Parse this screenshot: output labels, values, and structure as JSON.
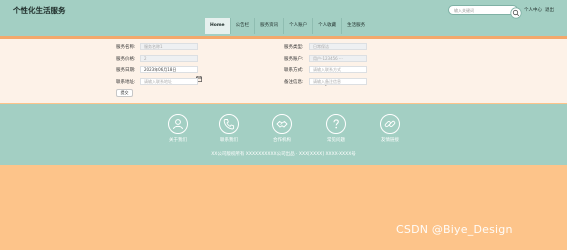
{
  "header": {
    "logo": "个性化生活服务",
    "search_placeholder": "输入关键词",
    "user_center": "个人中心",
    "logout": "退出",
    "nav": [
      "Home",
      "公告栏",
      "服务资讯",
      "个人账户",
      "个人收藏",
      "生活服务"
    ]
  },
  "form": {
    "service_name_label": "服务名称:",
    "service_name_value": "服务名称1",
    "service_type_label": "服务类型:",
    "service_type_value": "日常保洁",
    "service_count_label": "服务价格:",
    "service_count_value": "2",
    "service_account_label": "服务账户:",
    "service_account_value": "用户-123456 ···",
    "service_date_label": "服务日期:",
    "service_date_value": "2023年06月18日",
    "contact_method_label": "联系方式:",
    "contact_method_placeholder": "请输入联系方式",
    "contact_address_label": "联系地址:",
    "contact_address_placeholder": "请输入联系地址",
    "remark_label": "备注信息:",
    "remark_placeholder": "请输入备注信息",
    "submit_label": "提交"
  },
  "footer": {
    "links": [
      "关于我们",
      "联系我们",
      "合作机构",
      "常见问题",
      "友情链接"
    ],
    "copyright": "XX公司版权所有 XXXXXXXXXX公司出品 · XXX[XXXX] XXXX-XXXX号"
  },
  "watermark": "CSDN @Biye_Design",
  "colors": {
    "header_bg": "#a3cfc3",
    "page_bg": "#fdc48a",
    "form_bg": "#fdf2e8",
    "stripe": "#f4a86b"
  }
}
